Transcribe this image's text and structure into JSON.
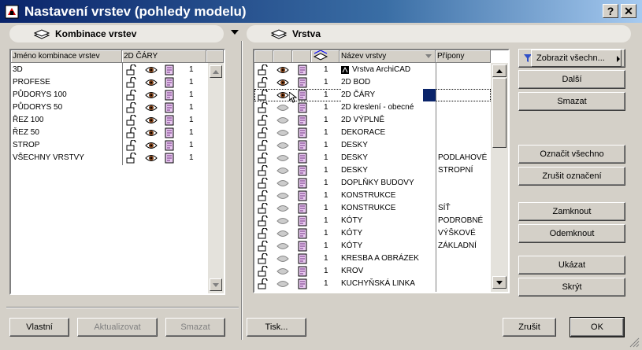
{
  "window": {
    "title": "Nastavení vrstev (pohledy modelu)",
    "help_label": "?",
    "close_label": "✕"
  },
  "left": {
    "header": "Kombinace vrstev",
    "columns": [
      "Jméno kombinace vrstev",
      "2D ČÁRY"
    ],
    "rows": [
      {
        "name": "3D",
        "num": "1"
      },
      {
        "name": "PROFESE",
        "num": "1"
      },
      {
        "name": "PŮDORYS 100",
        "num": "1"
      },
      {
        "name": "PŮDORYS 50",
        "num": "1"
      },
      {
        "name": "ŘEZ 100",
        "num": "1"
      },
      {
        "name": "ŘEZ 50",
        "num": "1"
      },
      {
        "name": "STROP",
        "num": "1"
      },
      {
        "name": "VŠECHNY VRSTVY",
        "num": "1"
      }
    ],
    "buttons": {
      "new": "Vlastní",
      "update": "Aktualizovat",
      "delete": "Smazat"
    }
  },
  "right": {
    "header": "Vrstva",
    "columns": {
      "name": "Název vrstvy",
      "ext": "Přípony"
    },
    "rows": [
      {
        "num": "1",
        "name": "Vrstva ArchiCAD",
        "ext": "",
        "visible": true
      },
      {
        "num": "1",
        "name": "2D BOD",
        "ext": "",
        "visible": true
      },
      {
        "num": "1",
        "name": "2D ČÁRY",
        "ext": "",
        "visible": true,
        "selected": true
      },
      {
        "num": "1",
        "name": "2D kreslení - obecné",
        "ext": "",
        "visible": false
      },
      {
        "num": "1",
        "name": "2D VÝPLNĚ",
        "ext": "",
        "visible": false
      },
      {
        "num": "1",
        "name": "DEKORACE",
        "ext": "",
        "visible": false
      },
      {
        "num": "1",
        "name": "DESKY",
        "ext": "",
        "visible": false
      },
      {
        "num": "1",
        "name": "DESKY",
        "ext": "PODLAHOVÉ",
        "visible": false
      },
      {
        "num": "1",
        "name": "DESKY",
        "ext": "STROPNÍ",
        "visible": false
      },
      {
        "num": "1",
        "name": "DOPLŇKY BUDOVY",
        "ext": "",
        "visible": false
      },
      {
        "num": "1",
        "name": "KONSTRUKCE",
        "ext": "",
        "visible": false
      },
      {
        "num": "1",
        "name": "KONSTRUKCE",
        "ext": "SÍŤ",
        "visible": false
      },
      {
        "num": "1",
        "name": "KÓTY",
        "ext": "PODROBNÉ",
        "visible": false
      },
      {
        "num": "1",
        "name": "KÓTY",
        "ext": "VÝŠKOVÉ",
        "visible": false
      },
      {
        "num": "1",
        "name": "KÓTY",
        "ext": "ZÁKLADNÍ",
        "visible": false
      },
      {
        "num": "1",
        "name": "KRESBA A OBRÁZEK",
        "ext": "",
        "visible": false
      },
      {
        "num": "1",
        "name": "KROV",
        "ext": "",
        "visible": false
      },
      {
        "num": "1",
        "name": "KUCHYŇSKÁ LINKA",
        "ext": "",
        "visible": false
      }
    ]
  },
  "side_buttons": {
    "filter": "Zobrazit všechn...",
    "next": "Další",
    "delete": "Smazat",
    "select_all": "Označit všechno",
    "deselect": "Zrušit označení",
    "lock": "Zamknout",
    "unlock": "Odemknout",
    "show": "Ukázat",
    "hide": "Skrýt"
  },
  "bottom": {
    "print": "Tisk...",
    "cancel": "Zrušit",
    "ok": "OK"
  },
  "icons": [
    "app-icon",
    "layers-icon",
    "lock-open-icon",
    "eye-icon",
    "layer-stack-icon",
    "filter-icon",
    "scroll-up-icon",
    "scroll-down-icon",
    "cursor-icon"
  ]
}
